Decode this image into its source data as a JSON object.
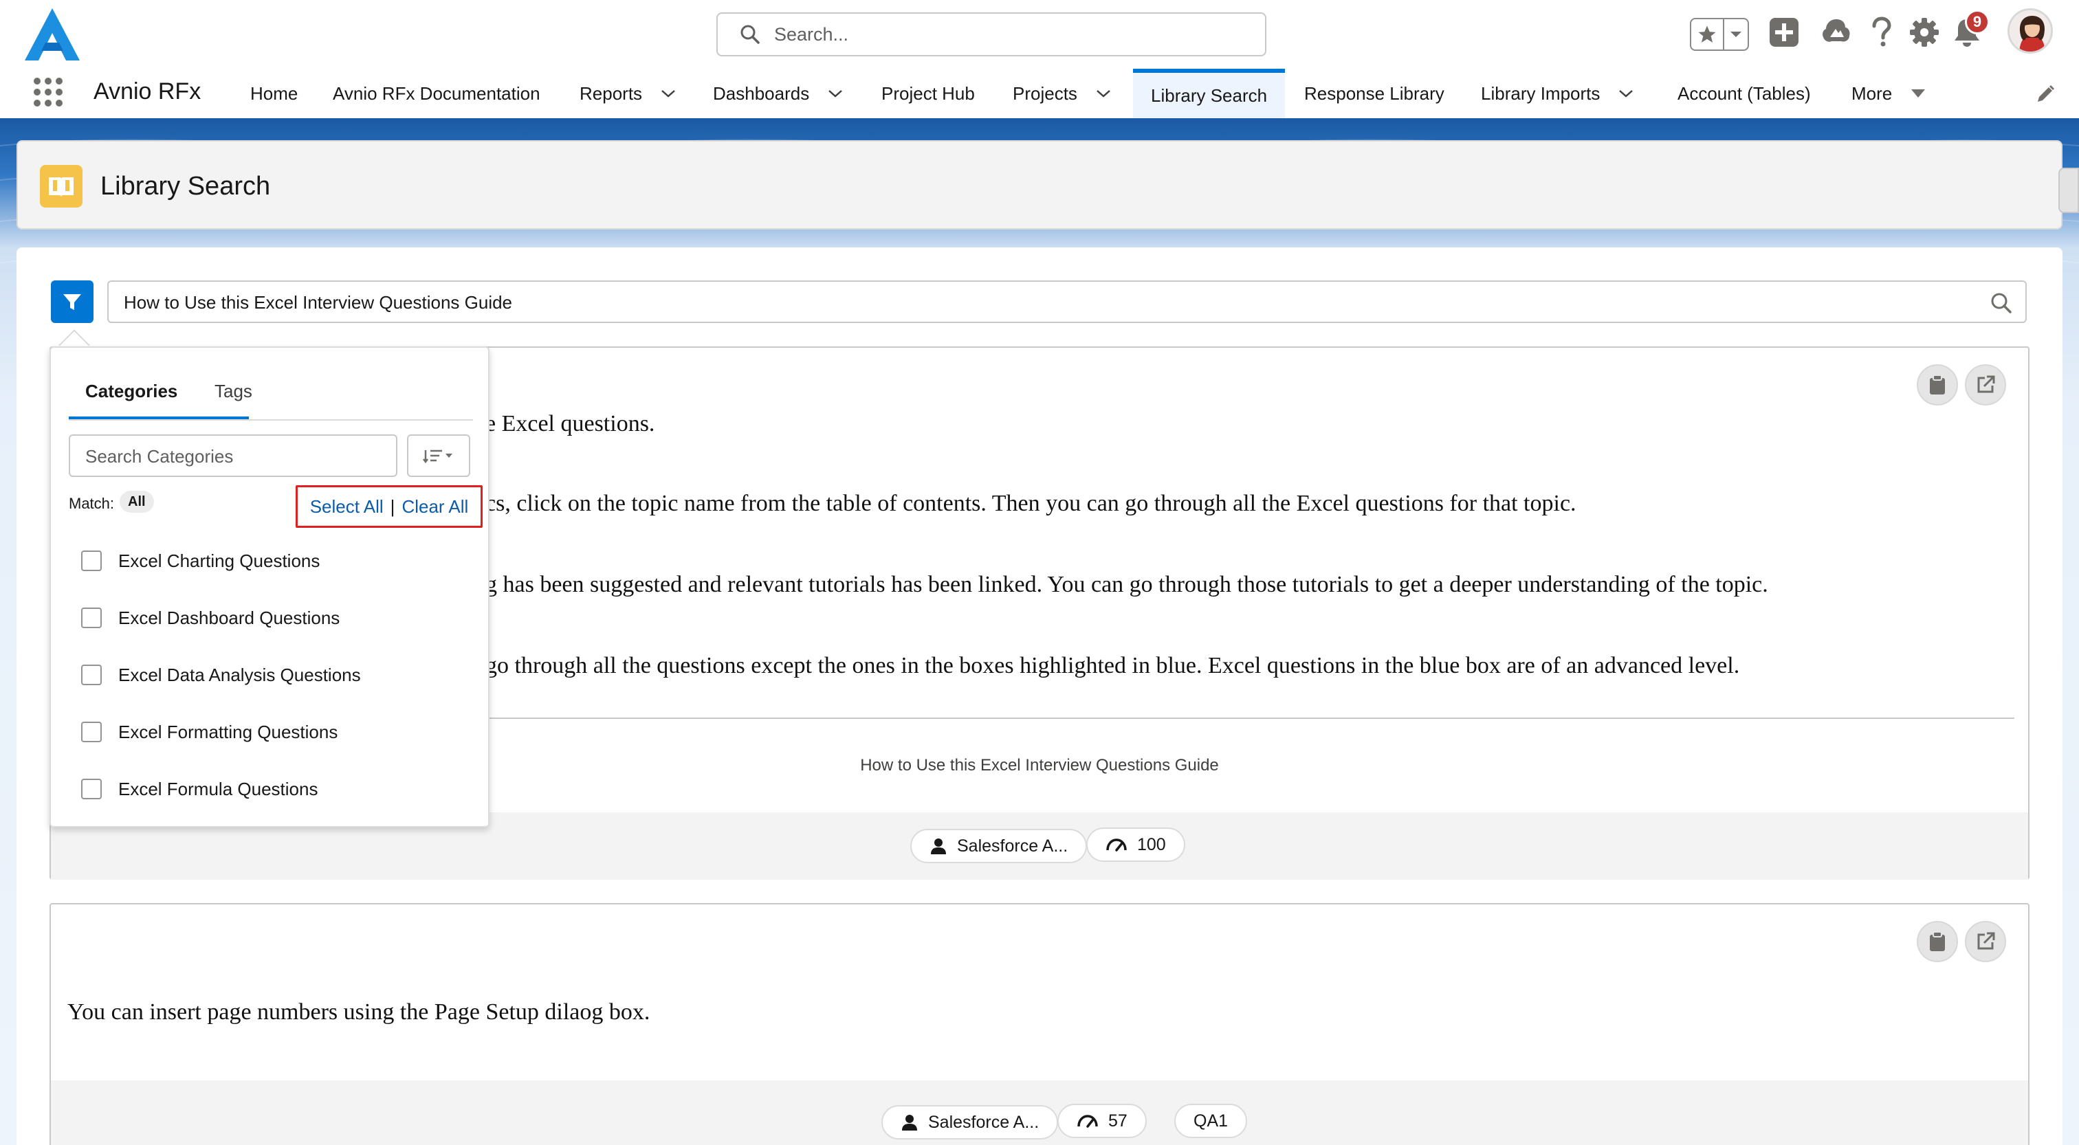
{
  "global_header": {
    "search_placeholder": "Search...",
    "notification_count": "9"
  },
  "nav": {
    "app_name": "Avnio RFx",
    "items": [
      {
        "label": "Home"
      },
      {
        "label": "Avnio RFx Documentation"
      },
      {
        "label": "Reports"
      },
      {
        "label": "Dashboards"
      },
      {
        "label": "Project Hub"
      },
      {
        "label": "Projects"
      },
      {
        "label": "Library Search"
      },
      {
        "label": "Response Library"
      },
      {
        "label": "Library Imports"
      },
      {
        "label": "Account (Tables)"
      },
      {
        "label": "More"
      }
    ]
  },
  "page_header": {
    "title": "Library Search"
  },
  "search": {
    "value": "How to Use this Excel Interview Questions Guide"
  },
  "filter_panel": {
    "tabs": [
      "Categories",
      "Tags"
    ],
    "search_placeholder": "Search Categories",
    "match_label": "Match:",
    "match_value": "All",
    "select_all": "Select All",
    "separator": "|",
    "clear_all": "Clear All",
    "categories": [
      "Excel Charting Questions",
      "Excel Dashboard Questions",
      "Excel Data Analysis Questions",
      "Excel Formatting Questions",
      "Excel Formula Questions"
    ]
  },
  "results": [
    {
      "lines": [
        "e Excel questions.",
        "cs, click on the topic name from the table of contents. Then you can go through all the Excel questions for that topic.",
        "g has been suggested and relevant tutorials has been linked. You can go through those tutorials to get a deeper understanding of the topic.",
        "go through all the questions except the ones in the boxes highlighted in blue. Excel questions in the blue box are of an advanced level."
      ],
      "title": "How to Use this Excel Interview Questions Guide",
      "owner": "Salesforce A...",
      "score": "100"
    },
    {
      "lines": [
        "You can insert page numbers using the Page Setup dilaog box."
      ],
      "owner": "Salesforce A...",
      "score": "57",
      "tag": "QA1"
    }
  ]
}
